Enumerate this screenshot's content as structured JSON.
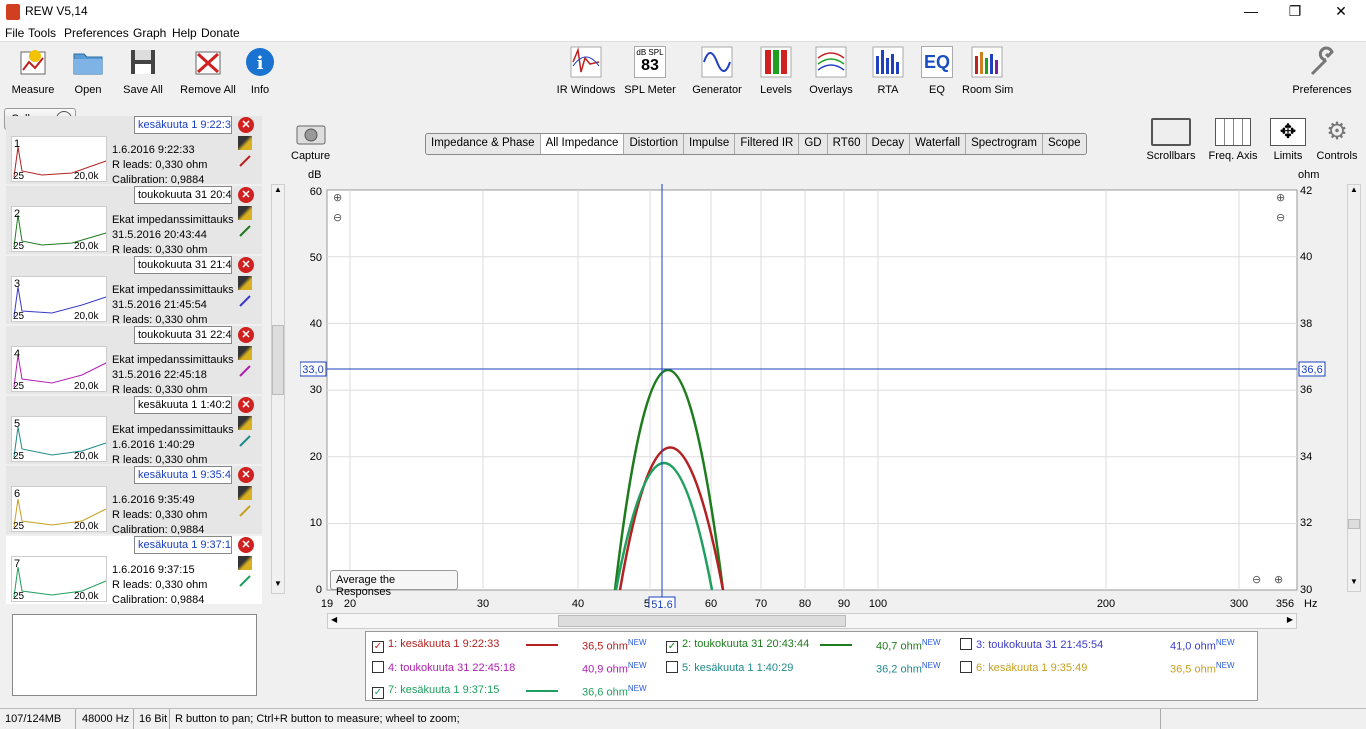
{
  "window": {
    "title": "REW V5,14",
    "minimize": "—",
    "restore": "❐",
    "close": "✕"
  },
  "menu": [
    "File",
    "Tools",
    "Preferences",
    "Graph",
    "Help",
    "Donate"
  ],
  "toolbar_left": [
    "Measure",
    "Open",
    "Save All",
    "Remove All",
    "Info"
  ],
  "toolbar_center": [
    "IR Windows",
    "SPL Meter",
    "Generator",
    "Levels",
    "Overlays",
    "RTA",
    "EQ",
    "Room Sim"
  ],
  "spl_meter": {
    "top": "dB SPL",
    "value": "83"
  },
  "toolbar_right": "Preferences",
  "collapse_label": "Collapse",
  "measurements": [
    {
      "num": "1",
      "name": "kesäkuuta 1 9:22:33",
      "line1": "1.6.2016 9:22:33",
      "line2": "R leads: 0,330 ohm",
      "line3": "Calibration: 0,9884",
      "color": "#b22222"
    },
    {
      "num": "2",
      "name": "toukokuuta 31 20:43:44",
      "line1": "Ekat impedanssimittauks",
      "line2": "31.5.2016 20:43:44",
      "line3": "R leads: 0,330 ohm",
      "color": "#1e7b1e"
    },
    {
      "num": "3",
      "name": "toukokuuta 31 21:45:54",
      "line1": "Ekat impedanssimittauks",
      "line2": "31.5.2016 21:45:54",
      "line3": "R leads: 0,330 ohm",
      "color": "#3b3bc7"
    },
    {
      "num": "4",
      "name": "toukokuuta 31 22:45:18",
      "line1": "Ekat impedanssimittauks",
      "line2": "31.5.2016 22:45:18",
      "line3": "R leads: 0,330 ohm",
      "color": "#b020b0"
    },
    {
      "num": "5",
      "name": "kesäkuuta 1 1:40:29",
      "line1": "Ekat impedanssimittauks",
      "line2": "1.6.2016 1:40:29",
      "line3": "R leads: 0,330 ohm",
      "color": "#1f8a8a"
    },
    {
      "num": "6",
      "name": "kesäkuuta 1 9:35:49",
      "line1": "1.6.2016 9:35:49",
      "line2": "R leads: 0,330 ohm",
      "line3": "Calibration: 0,9884",
      "color": "#c8a020"
    },
    {
      "num": "7",
      "name": "kesäkuuta 1 9:37:15",
      "line1": "1.6.2016 9:37:15",
      "line2": "R leads: 0,330 ohm",
      "line3": "Calibration: 0,9884",
      "color": "#20a060"
    }
  ],
  "thumb_labels": {
    "low": "25",
    "high": "20,0k"
  },
  "capture_label": "Capture",
  "graph_tabs": [
    "Impedance & Phase",
    "All Impedance",
    "Distortion",
    "Impulse",
    "Filtered IR",
    "GD",
    "RT60",
    "Decay",
    "Waterfall",
    "Spectrogram",
    "Scope"
  ],
  "selected_tab": "All Impedance",
  "right_controls": [
    "Scrollbars",
    "Freq. Axis",
    "Limits",
    "Controls"
  ],
  "plot": {
    "left_unit": "dB",
    "right_unit": "ohm",
    "x_unit": "Hz",
    "left_ticks": [
      "60",
      "50",
      "40",
      "30",
      "20",
      "10",
      "0"
    ],
    "right_ticks": [
      "42",
      "40",
      "38",
      "36",
      "34",
      "32",
      "30"
    ],
    "x_ticks": [
      "19",
      "20",
      "30",
      "40",
      "50",
      "60",
      "70",
      "80",
      "90",
      "100",
      "200",
      "300",
      "356"
    ],
    "cursor_left": "33,0",
    "cursor_right": "36,6",
    "cursor_x": "51,6",
    "avg_button": "Average the Responses"
  },
  "legend": [
    {
      "label": "1: kesäkuuta 1 9:22:33",
      "checked": true,
      "value": "36,5 ohm",
      "color": "#b22222"
    },
    {
      "label": "2: toukokuuta 31 20:43:44",
      "checked": true,
      "value": "40,7 ohm",
      "color": "#1e7b1e"
    },
    {
      "label": "3: toukokuuta 31 21:45:54",
      "checked": false,
      "value": "41,0 ohm",
      "color": "#3b3bc7"
    },
    {
      "label": "4: toukokuuta 31 22:45:18",
      "checked": false,
      "value": "40,9 ohm",
      "color": "#b020b0"
    },
    {
      "label": "5: kesäkuuta 1 1:40:29",
      "checked": false,
      "value": "36,2 ohm",
      "color": "#1f8a8a"
    },
    {
      "label": "6: kesäkuuta 1 9:35:49",
      "checked": false,
      "value": "36,5 ohm",
      "color": "#c8a020"
    },
    {
      "label": "7: kesäkuuta 1 9:37:15",
      "checked": true,
      "value": "36,6 ohm",
      "color": "#20a060"
    }
  ],
  "legend_new": "NEW",
  "status": {
    "memory": "107/124MB",
    "rate": "48000 Hz",
    "bits": "16 Bit",
    "hint": "R button to pan; Ctrl+R button to measure; wheel to zoom;"
  }
}
